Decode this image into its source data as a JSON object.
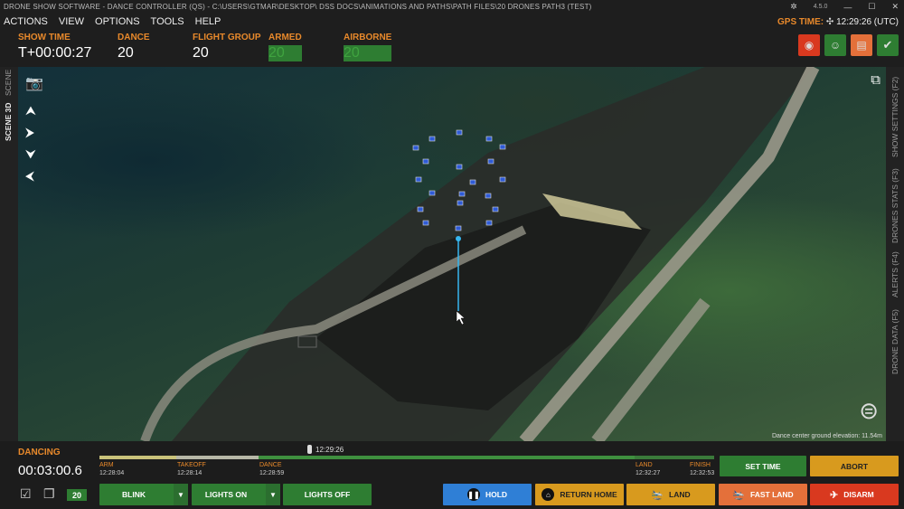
{
  "window": {
    "title": "DRONE SHOW SOFTWARE - DANCE CONTROLLER (QS) - C:\\USERS\\GTMAR\\DESKTOP\\ DSS DOCS\\ANIMATIONS AND PATHS\\PATH FILES\\20 DRONES PATH3 (TEST)",
    "version": "4.5.0"
  },
  "menu": [
    "ACTIONS",
    "VIEW",
    "OPTIONS",
    "TOOLS",
    "HELP"
  ],
  "gps": {
    "label": "GPS TIME:",
    "value": "12:29:26 (UTC)"
  },
  "status": {
    "show_time": {
      "label": "SHOW TIME",
      "value": "T+00:00:27"
    },
    "dance": {
      "label": "DANCE",
      "value": "20"
    },
    "flight_group": {
      "label": "FLIGHT GROUP",
      "value": "20"
    },
    "armed": {
      "label": "ARMED",
      "value": "20"
    },
    "airborne": {
      "label": "AIRBORNE",
      "value": "20"
    }
  },
  "left_tabs": [
    "SCENE",
    "SCENE 3D"
  ],
  "right_tabs": [
    "SHOW SETTINGS (F2)",
    "DRONES STATS (F3)",
    "ALERTS (F4)",
    "DRONE DATA (F5)"
  ],
  "viewport": {
    "elevation_note": "Dance center ground elevation: 11.54m"
  },
  "bottom": {
    "state": "DANCING",
    "elapsed": "00:03:00.6",
    "current_time": "12:29:26",
    "drone_count": "20",
    "phases": [
      {
        "name": "ARM",
        "time": "12:28:04"
      },
      {
        "name": "TAKEOFF",
        "time": "12:28:14"
      },
      {
        "name": "DANCE",
        "time": "12:28:59"
      },
      {
        "name": "LAND",
        "time": "12:32:27"
      },
      {
        "name": "FINISH",
        "time": "12:32:53"
      }
    ],
    "progress": 0.34
  },
  "buttons": {
    "blink": "BLINK",
    "lights_on": "LIGHTS ON",
    "lights_off": "LIGHTS OFF",
    "set_time": "SET TIME",
    "abort": "ABORT",
    "hold": "HOLD",
    "return_home": "RETURN HOME",
    "land": "LAND",
    "fast_land": "FAST LAND",
    "disarm": "DISARM"
  },
  "colors": {
    "accent": "#e8892b",
    "ok": "#2e7d32",
    "warn": "#d89a1e",
    "danger": "#d9391f",
    "info": "#2f7fd6"
  }
}
